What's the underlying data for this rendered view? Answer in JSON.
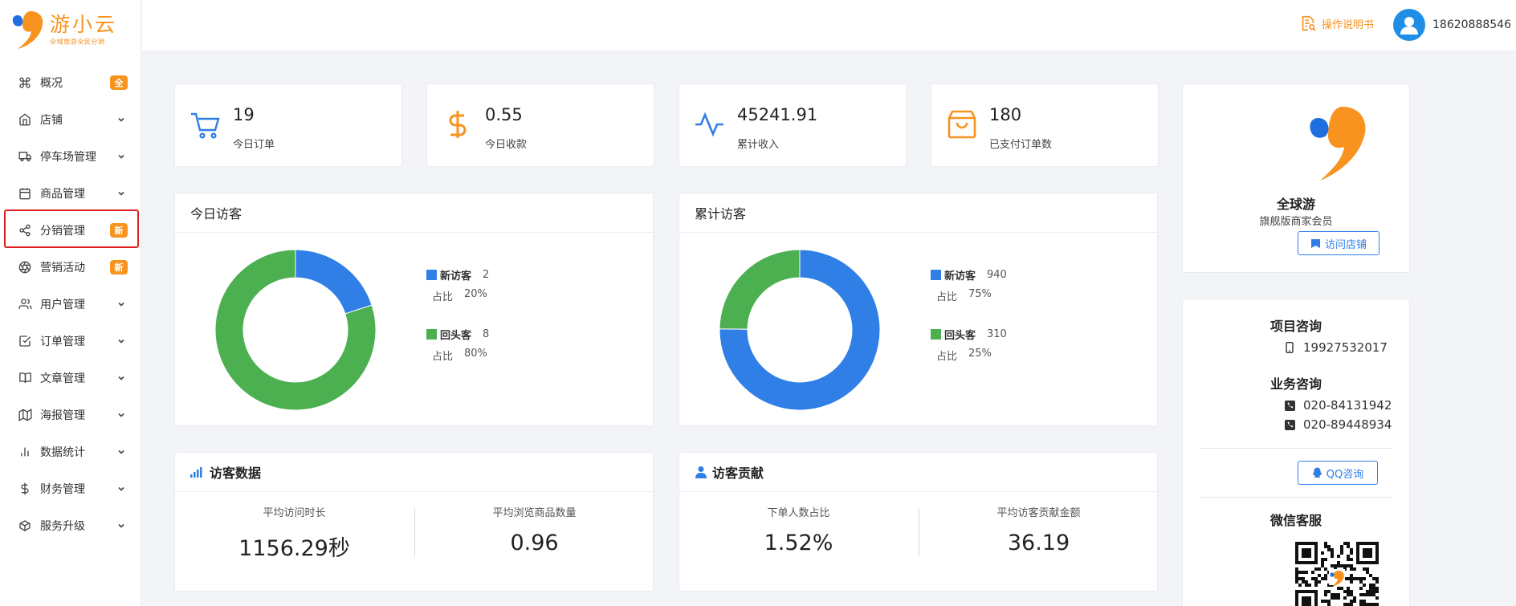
{
  "brand": {
    "name": "游小云",
    "slogan": "全域旅游全民分销"
  },
  "sidebar": {
    "items": [
      {
        "label": "概况",
        "icon": "command-icon",
        "badge": "全",
        "has_chevron": false
      },
      {
        "label": "店铺",
        "icon": "home-icon",
        "badge": "",
        "has_chevron": true
      },
      {
        "label": "停车场管理",
        "icon": "truck-icon",
        "badge": "",
        "has_chevron": true
      },
      {
        "label": "商品管理",
        "icon": "calendar-icon",
        "badge": "",
        "has_chevron": true
      },
      {
        "label": "分销管理",
        "icon": "share-icon",
        "badge": "新",
        "has_chevron": false
      },
      {
        "label": "营销活动",
        "icon": "aperture-icon",
        "badge": "新",
        "has_chevron": false
      },
      {
        "label": "用户管理",
        "icon": "users-icon",
        "badge": "",
        "has_chevron": true
      },
      {
        "label": "订单管理",
        "icon": "check-square-icon",
        "badge": "",
        "has_chevron": true
      },
      {
        "label": "文章管理",
        "icon": "book-open-icon",
        "badge": "",
        "has_chevron": true
      },
      {
        "label": "海报管理",
        "icon": "map-icon",
        "badge": "",
        "has_chevron": true
      },
      {
        "label": "数据统计",
        "icon": "bar-chart-icon",
        "badge": "",
        "has_chevron": true
      },
      {
        "label": "财务管理",
        "icon": "dollar-icon",
        "badge": "",
        "has_chevron": true
      },
      {
        "label": "服务升级",
        "icon": "codesandbox-icon",
        "badge": "",
        "has_chevron": true
      }
    ],
    "highlighted_index": 4
  },
  "header": {
    "manual_label": "操作说明书",
    "user_phone": "18620888546"
  },
  "stats": [
    {
      "value": "19",
      "label": "今日订单",
      "icon": "cart-icon"
    },
    {
      "value": "0.55",
      "label": "今日收款",
      "icon": "dollar-icon"
    },
    {
      "value": "45241.91",
      "label": "累计收入",
      "icon": "activity-icon"
    },
    {
      "value": "180",
      "label": "已支付订单数",
      "icon": "shopping-bag-icon"
    }
  ],
  "today_visitors": {
    "title": "今日访客",
    "new": {
      "name": "新访客",
      "value": "2",
      "ratio_label": "占比",
      "ratio": "20%"
    },
    "returning": {
      "name": "回头客",
      "value": "8",
      "ratio_label": "占比",
      "ratio": "80%"
    }
  },
  "total_visitors": {
    "title": "累计访客",
    "new": {
      "name": "新访客",
      "value": "940",
      "ratio_label": "占比",
      "ratio": "75%"
    },
    "returning": {
      "name": "回头客",
      "value": "310",
      "ratio_label": "占比",
      "ratio": "25%"
    }
  },
  "visitor_data": {
    "title": "访客数据",
    "metrics": [
      {
        "label": "平均访问时长",
        "value": "1156.29秒"
      },
      {
        "label": "平均浏览商品数量",
        "value": "0.96"
      }
    ]
  },
  "visitor_contribution": {
    "title": "访客贡献",
    "metrics": [
      {
        "label": "下单人数占比",
        "value": "1.52%"
      },
      {
        "label": "平均访客贡献金额",
        "value": "36.19"
      }
    ]
  },
  "brand_card": {
    "name": "全球游",
    "level": "旗舰版商家会员",
    "visit_label": "访问店铺"
  },
  "contact": {
    "project_title": "项目咨询",
    "project_phone": "19927532017",
    "business_title": "业务咨询",
    "business_phones": [
      "020-84131942",
      "020-89448934"
    ],
    "qq_label": "QQ咨询",
    "wechat_title": "微信客服"
  },
  "colors": {
    "accent_orange": "#f7931e",
    "primary_blue": "#2f7fe6",
    "green": "#4caf50",
    "highlight_red": "#e02020"
  },
  "chart_data": [
    {
      "type": "pie",
      "title": "今日访客",
      "categories": [
        "新访客",
        "回头客"
      ],
      "values": [
        2,
        8
      ],
      "colors": [
        "#2f7fe6",
        "#4caf50"
      ],
      "style": "donut",
      "legend": "right"
    },
    {
      "type": "pie",
      "title": "累计访客",
      "categories": [
        "新访客",
        "回头客"
      ],
      "values": [
        940,
        310
      ],
      "colors": [
        "#2f7fe6",
        "#4caf50"
      ],
      "style": "donut",
      "legend": "right"
    }
  ]
}
